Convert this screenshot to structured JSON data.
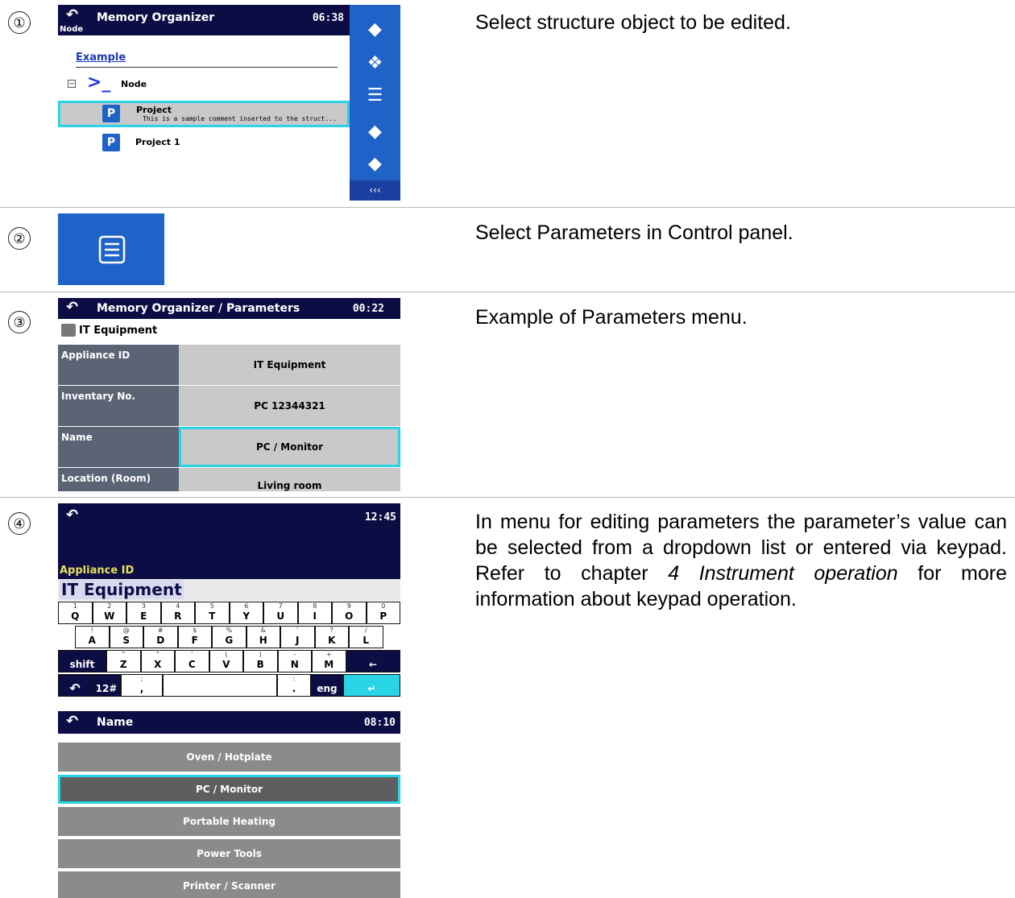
{
  "steps": [
    {
      "marker": "①",
      "text": "Select structure object to be edited."
    },
    {
      "marker": "②",
      "text": "Select Parameters in Control panel."
    },
    {
      "marker": "③",
      "text": "Example of Parameters menu."
    },
    {
      "marker": "④",
      "text_before": "In menu for editing parameters the parameter’s value can be selected from a dropdown list or entered via keypad. Refer to chapter ",
      "text_italic": "4 Instrument operation",
      "text_after": " for more information about keypad operation."
    }
  ],
  "screen1": {
    "title": "Memory Organizer",
    "time": "06:38",
    "location": "Node",
    "example_label": "Example",
    "node_label": "Node",
    "project_label": "Project",
    "project_comment": "This is a sample comment inserted to the struct...",
    "project1_label": "Project 1",
    "more_label": "‹‹‹"
  },
  "screen3": {
    "title": "Memory Organizer / Parameters",
    "time": "00:22",
    "object_label": "IT Equipment",
    "params": [
      {
        "label": "Appliance ID",
        "value": "IT Equipment"
      },
      {
        "label": "Inventary No.",
        "value": "PC 12344321"
      },
      {
        "label": "Name",
        "value": "PC / Monitor"
      },
      {
        "label": "Location (Room)",
        "value": "Living room"
      }
    ]
  },
  "screen4": {
    "time": "12:45",
    "field_label": "Appliance ID",
    "field_value": "IT Equipment",
    "row1": [
      [
        "1",
        "Q"
      ],
      [
        "2",
        "W"
      ],
      [
        "3",
        "E"
      ],
      [
        "4",
        "R"
      ],
      [
        "5",
        "T"
      ],
      [
        "6",
        "Y"
      ],
      [
        "7",
        "U"
      ],
      [
        "8",
        "I"
      ],
      [
        "9",
        "O"
      ],
      [
        "0",
        "P"
      ]
    ],
    "row2": [
      [
        "!",
        "A"
      ],
      [
        "@",
        "S"
      ],
      [
        "#",
        "D"
      ],
      [
        "$",
        "F"
      ],
      [
        "%",
        "G"
      ],
      [
        "&",
        "H"
      ],
      [
        "'",
        "J"
      ],
      [
        "?",
        "K"
      ],
      [
        "/",
        "L"
      ]
    ],
    "row3": [
      [
        "\"",
        "Z"
      ],
      [
        "\"",
        "X"
      ],
      [
        "'",
        "C"
      ],
      [
        "(",
        "V"
      ],
      [
        ")",
        "B"
      ],
      [
        "-",
        "N"
      ],
      [
        "+",
        "M"
      ]
    ],
    "shift_label": "shift",
    "backspace_label": "←",
    "mode_label": "12#",
    "comma_label": ",",
    "comma_sub": ";",
    "dot_label": ".",
    "dot_sub": ":",
    "lang_label": "eng",
    "enter_label": "↵"
  },
  "screen5": {
    "title": "Name",
    "time": "08:10",
    "options": [
      "Oven / Hotplate",
      "PC / Monitor",
      "Portable Heating",
      "Power Tools",
      "Printer / Scanner"
    ]
  },
  "colors": {
    "title_bar": "#0d0d45",
    "panel_blue": "#1f63c9",
    "highlight": "#28d4e6"
  }
}
